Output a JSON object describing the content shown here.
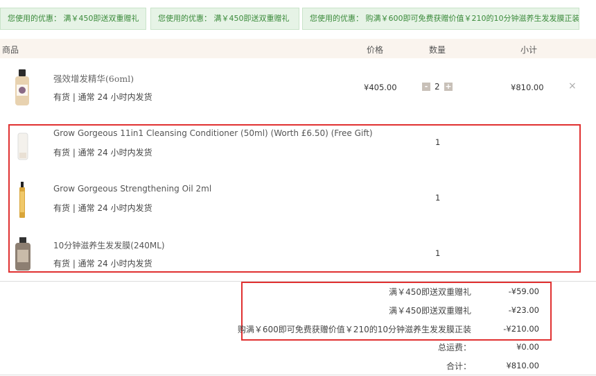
{
  "promos": [
    "您使用的优惠： 满￥450即送双重赠礼",
    "您使用的优惠： 满￥450即送双重赠礼",
    "您使用的优惠： 购满￥600即可免费获赠价值￥210的10分钟滋养生发发膜正装"
  ],
  "table_header": {
    "product": "商品",
    "price": "价格",
    "quantity": "数量",
    "subtotal": "小计"
  },
  "main_item": {
    "name": "强效增发精华(6oml)",
    "stock": "有货 | 通常 24 小时内发货",
    "price": "¥405.00",
    "quantity": "2",
    "subtotal": "¥810.00",
    "minus": "-",
    "plus": "+",
    "remove": "×"
  },
  "gift_items": [
    {
      "name": "Grow Gorgeous 11in1 Cleansing Conditioner (50ml) (Worth £6.50) (Free Gift)",
      "stock": "有货 | 通常 24 小时内发货",
      "quantity": "1"
    },
    {
      "name": "Grow Gorgeous Strengthening Oil 2ml",
      "stock": "有货 | 通常 24 小时内发货",
      "quantity": "1"
    },
    {
      "name": "10分钟滋养生发发膜(240ML)",
      "stock": "有货 | 通常 24 小时内发货",
      "quantity": "1"
    }
  ],
  "summary": {
    "discounts": [
      {
        "label": "满￥450即送双重赠礼",
        "value": "-¥59.00"
      },
      {
        "label": "满￥450即送双重赠礼",
        "value": "-¥23.00"
      },
      {
        "label": "购满￥600即可免费获赠价值￥210的10分钟滋养生发发膜正装",
        "value": "-¥210.00"
      }
    ],
    "shipping_label": "总运费：",
    "shipping_value": "¥0.00",
    "total_label": "合计：",
    "total_value": "¥810.00"
  },
  "colors": {
    "promo_bg": "#e6f3e6",
    "promo_text": "#3a8a3a",
    "header_bg": "#faf4ee",
    "highlight_border": "#e03030"
  }
}
